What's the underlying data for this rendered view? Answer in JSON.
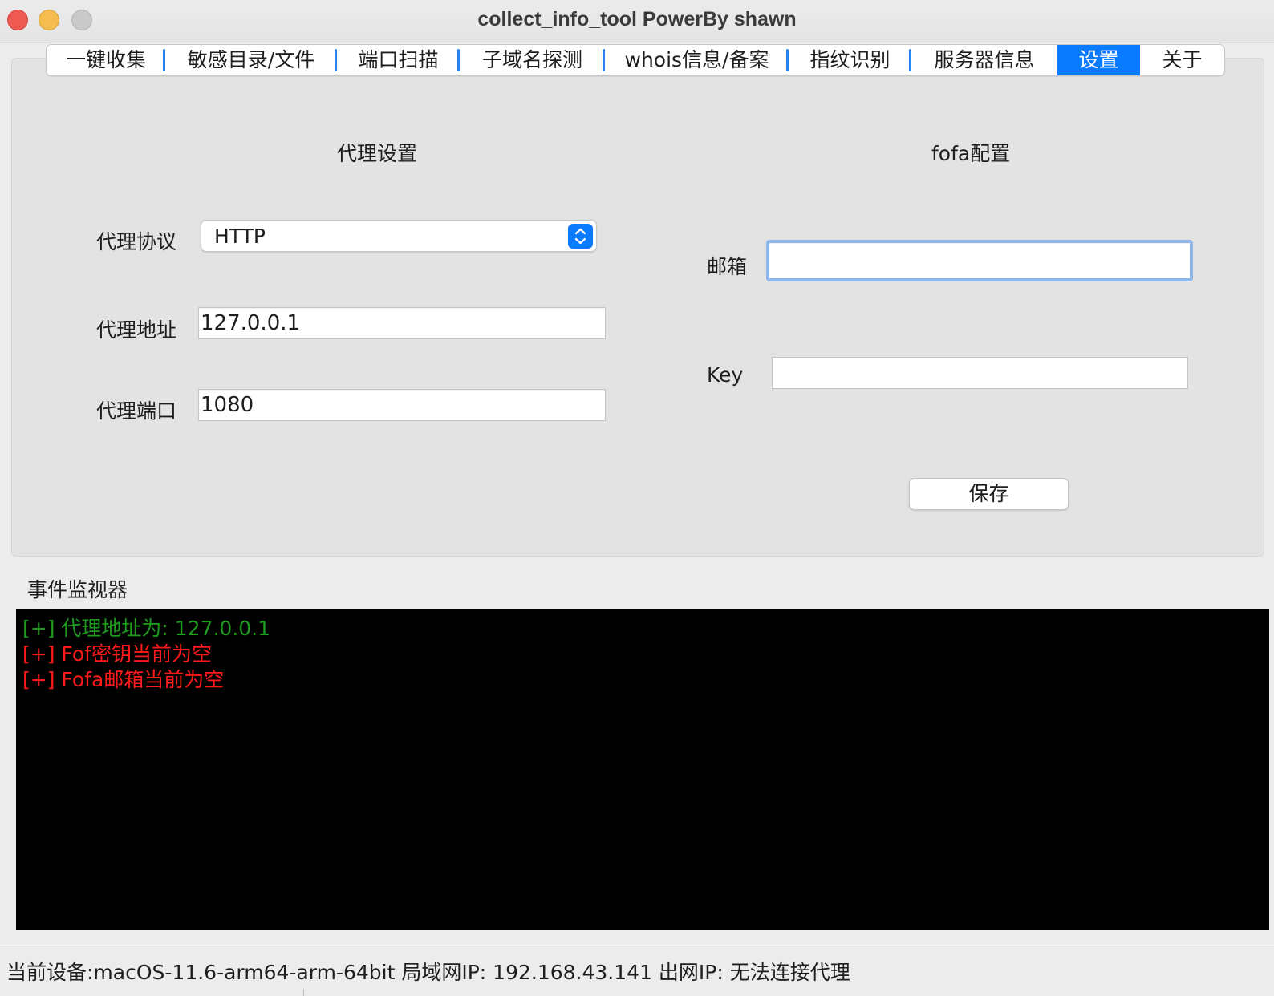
{
  "window": {
    "title": "collect_info_tool   PowerBy shawn"
  },
  "tabs": [
    {
      "label": "一键收集"
    },
    {
      "label": "敏感目录/文件"
    },
    {
      "label": "端口扫描"
    },
    {
      "label": "子域名探测"
    },
    {
      "label": "whois信息/备案"
    },
    {
      "label": "指纹识别"
    },
    {
      "label": "服务器信息"
    },
    {
      "label": "设置",
      "active": true
    },
    {
      "label": "关于"
    }
  ],
  "proxy": {
    "heading": "代理设置",
    "protocol_label": "代理协议",
    "protocol_value": "HTTP",
    "address_label": "代理地址",
    "address_value": "127.0.0.1",
    "port_label": "代理端口",
    "port_value": "1080"
  },
  "fofa": {
    "heading": "fofa配置",
    "email_label": "邮箱",
    "email_value": "",
    "key_label": "Key",
    "key_value": "",
    "save_label": "保存"
  },
  "monitor": {
    "label": "事件监视器",
    "lines": [
      {
        "text": "[+] 代理地址为:  127.0.0.1",
        "color": "#1f9a1f"
      },
      {
        "text": "[+] Fof密钥当前为空",
        "color": "#ff1a1a"
      },
      {
        "text": "[+] Fofa邮箱当前为空",
        "color": "#ff1a1a"
      }
    ]
  },
  "status": {
    "text": "当前设备:macOS-11.6-arm64-arm-64bit  局域网IP:  192.168.43.141  出网IP:  无法连接代理"
  },
  "colors": {
    "accent": "#0a7aff"
  }
}
